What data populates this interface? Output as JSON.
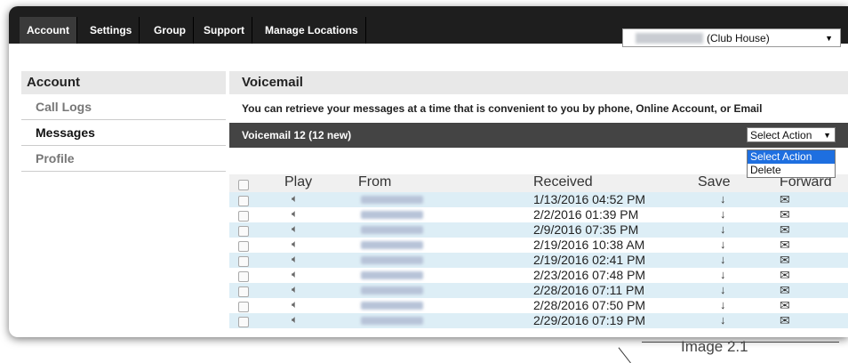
{
  "nav": {
    "tabs": [
      "Account",
      "Settings",
      "Group",
      "Support",
      "Manage Locations"
    ],
    "active_tab": "Account",
    "location_selected": "(Club House)"
  },
  "left_panel": {
    "title": "Account",
    "items": [
      "Call Logs",
      "Messages",
      "Profile"
    ],
    "active_item": "Messages"
  },
  "main": {
    "title": "Voicemail",
    "description": "You can retrieve your messages at a time that is convenient to you by phone, Online Account, or Email",
    "bar_label": "Voicemail 12 (12 new)",
    "select_action": {
      "value": "Select Action",
      "options": [
        "Select Action",
        "Delete"
      ],
      "highlighted": "Select Action"
    },
    "table": {
      "headers": [
        "Play",
        "From",
        "Received",
        "Save",
        "Forward"
      ],
      "rows": [
        {
          "received": "1/13/2016 04:52 PM"
        },
        {
          "received": "2/2/2016 01:39 PM"
        },
        {
          "received": "2/9/2016 07:35 PM"
        },
        {
          "received": "2/19/2016 10:38 AM"
        },
        {
          "received": "2/19/2016 02:41 PM"
        },
        {
          "received": "2/23/2016 07:48 PM"
        },
        {
          "received": "2/28/2016 07:11 PM"
        },
        {
          "received": "2/28/2016 07:50 PM"
        },
        {
          "received": "2/29/2016 07:19 PM"
        }
      ]
    }
  },
  "caption": "Image 2.1",
  "icons": {
    "play": "speaker-icon",
    "save": "down-arrow-icon",
    "forward": "envelope-icon"
  },
  "colors": {
    "nav_bg": "#1e1e1e",
    "bar_bg": "#444444",
    "row_alt": "#ddeef6",
    "highlight": "#1e6fe0"
  }
}
